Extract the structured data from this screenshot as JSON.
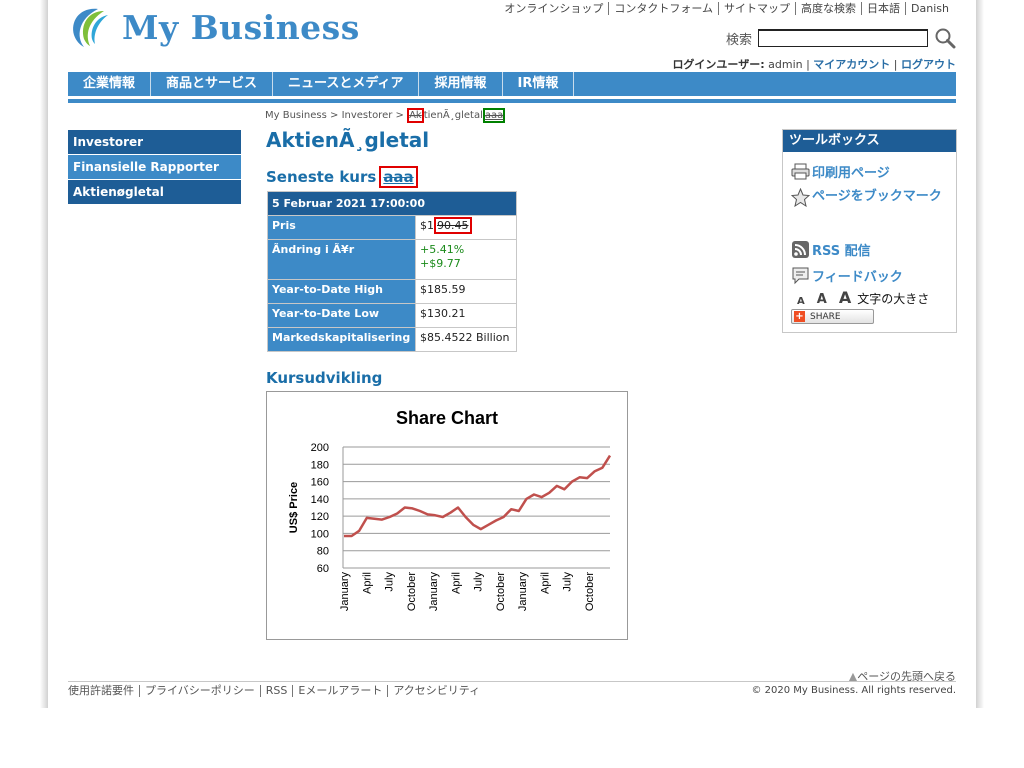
{
  "site": {
    "logo_text": "My Business"
  },
  "toplinks": [
    "オンラインショップ",
    "コンタクトフォーム",
    "サイトマップ",
    "高度な検索",
    "日本語",
    "Danish"
  ],
  "search": {
    "label": "検索",
    "value": ""
  },
  "user": {
    "label": "ログインユーザー:",
    "name": "admin",
    "sep1": " | ",
    "my_account": "マイアカウント",
    "sep2": " | ",
    "logout": "ログアウト"
  },
  "nav": [
    "企業情報",
    "商品とサービス",
    "ニュースとメディア",
    "採用情報",
    "IR情報"
  ],
  "leftnav": [
    "Investorer",
    "Finansielle Rapporter",
    "Aktienøgletal"
  ],
  "breadcrumb": {
    "home": "My Business",
    "sep1": " > ",
    "section": "Investorer",
    "sep2": " > ",
    "boxed": "Ak",
    "current": "tienÃ¸gletal",
    "tag": "aaa"
  },
  "page_title": "AktienÃ¸gletal",
  "latest": {
    "title": "Seneste kurs",
    "tag": "aaa"
  },
  "quote": {
    "header": "5 Februar 2021  17:00:00",
    "price_label": "Pris",
    "price_prefix": "$1",
    "price_struck": "90.45",
    "change_label": "Ãndring i Ã¥r",
    "change_pct": "+5.41%",
    "change_abs": "+$9.77",
    "ytd_high_label": "Year-to-Date High",
    "ytd_high": "$185.59",
    "ytd_low_label": "Year-to-Date Low",
    "ytd_low": "$130.21",
    "mcap_label": "Markedskapitalisering",
    "mcap": "$85.4522 Billion"
  },
  "chart_section_title": "Kursudvikling",
  "chart_data": {
    "type": "line",
    "title": "Share Chart",
    "ylabel": "US$ Price",
    "xlabel": "",
    "ylim": [
      60,
      200
    ],
    "yticks": [
      60,
      80,
      100,
      120,
      140,
      160,
      180,
      200
    ],
    "xticks": [
      "January",
      "April",
      "July",
      "October",
      "January",
      "April",
      "July",
      "October",
      "January",
      "April",
      "July",
      "October"
    ],
    "grid": true,
    "color": "#c0504d",
    "series": [
      {
        "values": [
          97,
          97,
          103,
          118,
          117,
          116,
          119,
          123,
          130,
          129,
          126,
          122,
          121,
          119,
          124,
          130,
          119,
          110,
          105,
          110,
          115,
          119,
          128,
          126,
          140,
          145,
          142,
          147,
          155,
          151,
          160,
          165,
          164,
          172,
          176,
          190
        ]
      }
    ]
  },
  "toolbox": {
    "title": "ツールボックス",
    "print": "印刷用ページ",
    "bookmark": "ページをブックマーク",
    "rss": "RSS 配信",
    "feedback": "フィードバック",
    "font_a1": "A",
    "font_a2": "A",
    "font_a3": "A",
    "font_label": "文字の大きさ",
    "share": "SHARE"
  },
  "footer": {
    "backtop": "ページの先頭へ戻る",
    "links": [
      "使用許諾要件",
      "プライバシーポリシー",
      "RSS",
      "Eメールアラート",
      "アクセシビリティ"
    ],
    "copyright": "© 2020 My Business. All rights reserved."
  }
}
